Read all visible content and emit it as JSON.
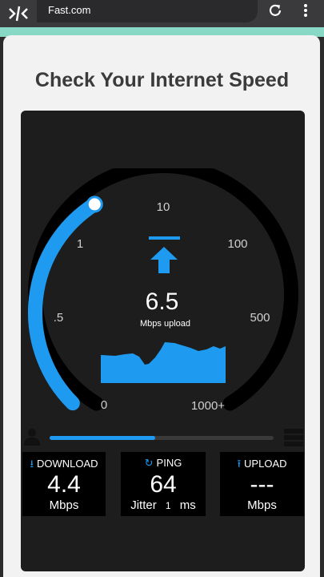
{
  "browser": {
    "url": "Fast.com",
    "logo_icon": "capcut-logo-icon",
    "reload_icon": "reload-icon",
    "menu_icon": "more-vert-icon"
  },
  "page": {
    "title": "Check Your Internet Speed"
  },
  "gauge": {
    "scale_labels": [
      "0",
      ".5",
      "1",
      "10",
      "100",
      "500",
      "1000+"
    ],
    "current_value": "6.5",
    "unit_label": "Mbps upload",
    "mode_icon": "upload-arrow-icon",
    "accent_color": "#1e9bf0",
    "progress_fraction": 0.38
  },
  "test_progress": 0.47,
  "stats": {
    "download": {
      "icon": "download-icon",
      "label": "DOWNLOAD",
      "value": "4.4",
      "unit": "Mbps"
    },
    "ping": {
      "icon": "refresh-icon",
      "label": "PING",
      "value": "64",
      "jitter_label": "Jitter",
      "jitter_value": "1",
      "jitter_unit": "ms"
    },
    "upload": {
      "icon": "upload-icon",
      "label": "UPLOAD",
      "value": "---",
      "unit": "Mbps"
    }
  }
}
